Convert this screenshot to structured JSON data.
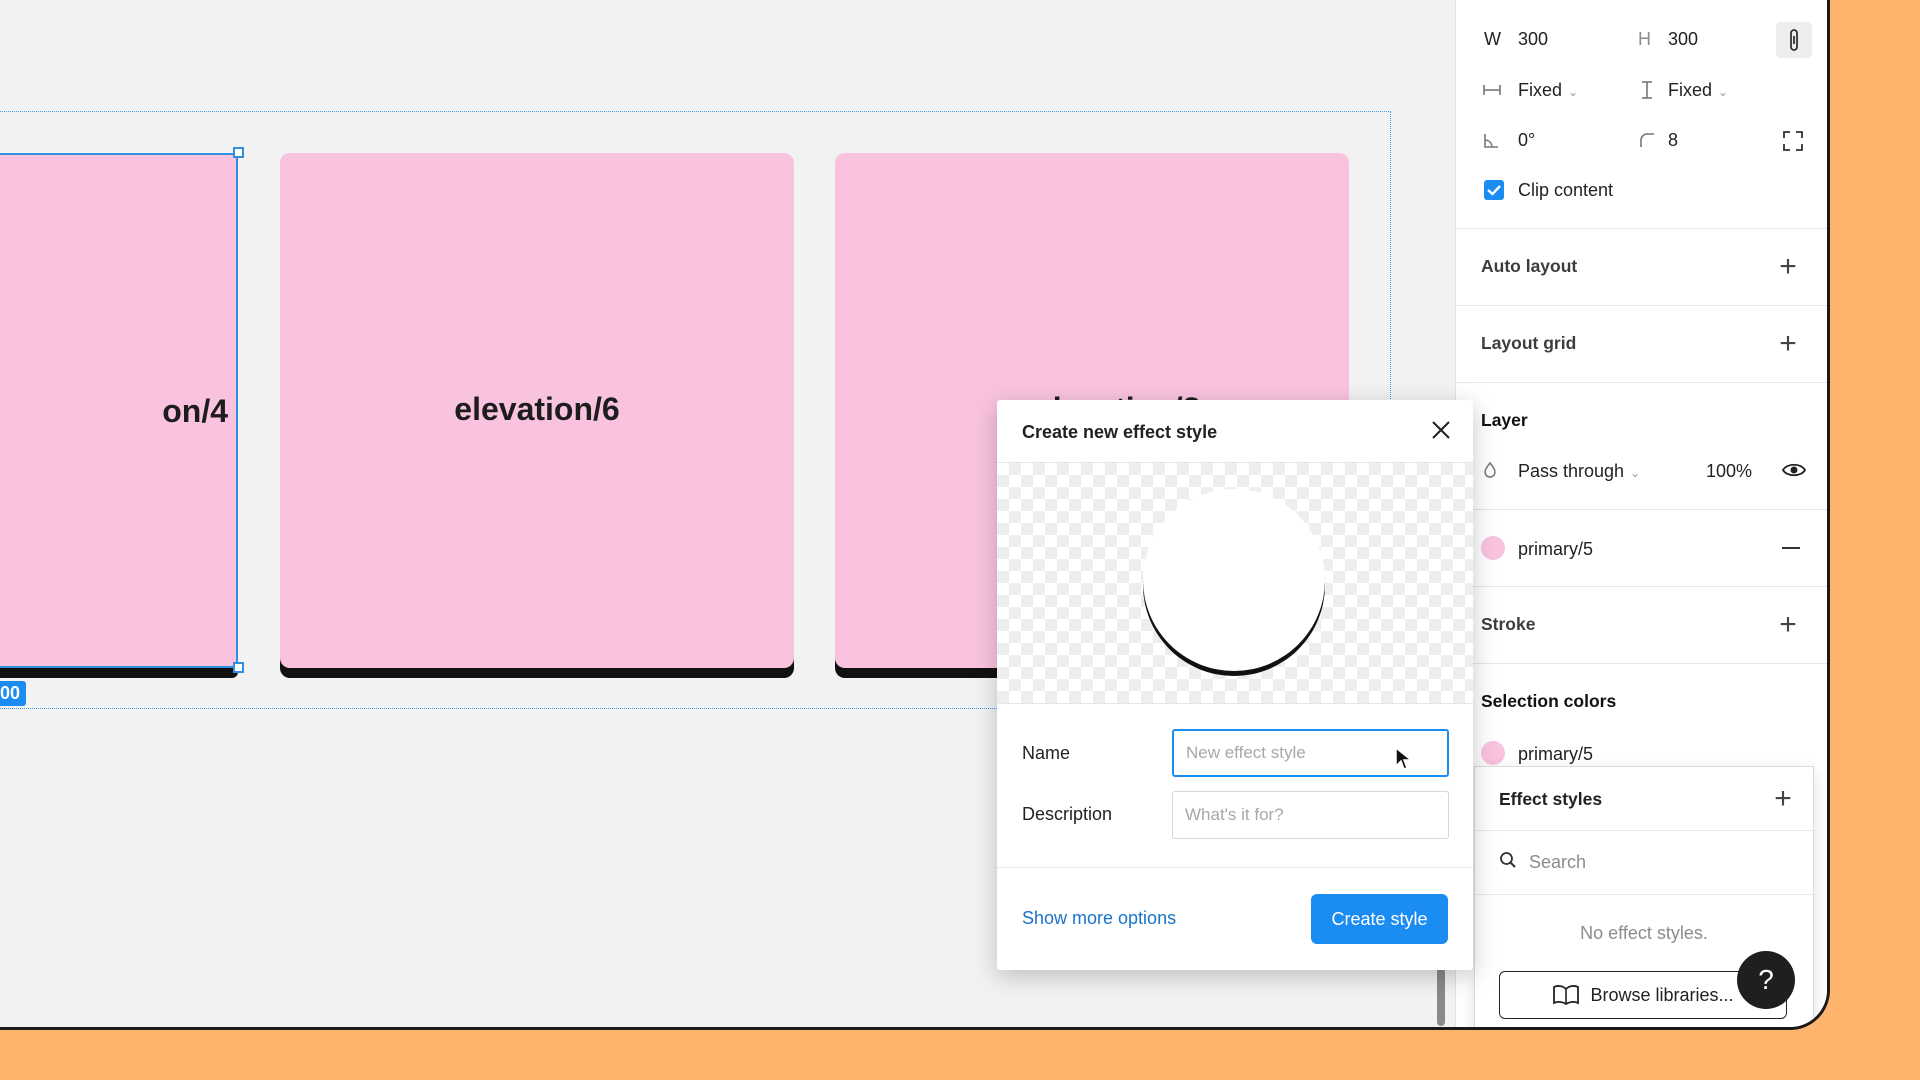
{
  "canvas": {
    "cards": [
      {
        "label": "on/4"
      },
      {
        "label": "elevation/6"
      },
      {
        "label": "elevation/8"
      }
    ],
    "dimension_badge": "00"
  },
  "properties": {
    "width_label": "W",
    "width_value": "300",
    "height_label": "H",
    "height_value": "300",
    "h_resizing": "Fixed",
    "v_resizing": "Fixed",
    "rotation": "0°",
    "corner_radius": "8",
    "clip_content_label": "Clip content",
    "clip_content_checked": true
  },
  "sections": {
    "auto_layout": "Auto layout",
    "layout_grid": "Layout grid",
    "layer": "Layer",
    "layer_blend": "Pass through",
    "layer_opacity": "100%",
    "fill_name": "primary/5",
    "stroke": "Stroke",
    "selection_colors": "Selection colors",
    "selection_color_name": "primary/5"
  },
  "effect_styles": {
    "title": "Effect styles",
    "search_placeholder": "Search",
    "empty_text": "No effect styles.",
    "browse_label": "Browse libraries...",
    "help_label": "?"
  },
  "dialog": {
    "title": "Create new effect style",
    "name_label": "Name",
    "name_placeholder": "New effect style",
    "description_label": "Description",
    "description_placeholder": "What's it for?",
    "more_options": "Show more options",
    "create_button": "Create style"
  },
  "colors": {
    "card_fill": "#f9c3df",
    "selection_blue": "#1b8cf2",
    "background": "#ffb46e"
  }
}
